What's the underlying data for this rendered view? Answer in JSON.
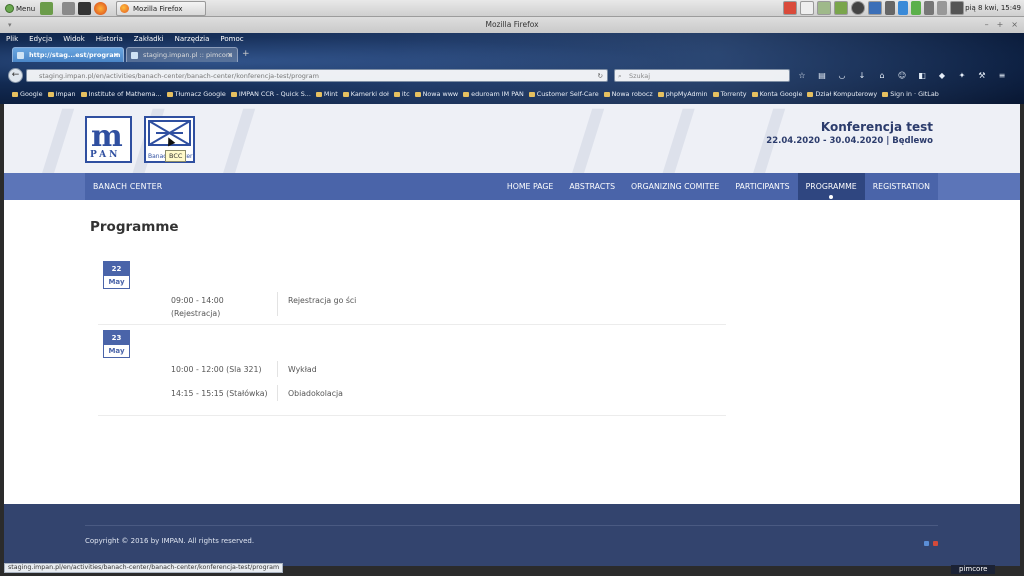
{
  "desktop": {
    "menu_label": "Menu",
    "window_button_label": "Mozilla Firefox",
    "clock": "pią 8 kwi, 15:49"
  },
  "window": {
    "title": "Mozilla Firefox"
  },
  "browser": {
    "menubar": [
      "Plik",
      "Edycja",
      "Widok",
      "Historia",
      "Zakładki",
      "Narzędzia",
      "Pomoc"
    ],
    "tabs": [
      {
        "label": "http://stag...est/program",
        "active": true
      },
      {
        "label": "staging.impan.pl :: pimcore",
        "active": false
      }
    ],
    "url": "staging.impan.pl/en/activities/banach-center/banach-center/konferencja-test/program",
    "search_placeholder": "Szukaj",
    "bookmarks": [
      "Google",
      "impan",
      "Institute of Mathema...",
      "Tłumacz Google",
      "IMPAN CCR - Quick S...",
      "Mint",
      "Kamerki doł",
      "itc",
      "Nowa www",
      "eduroam IM PAN",
      "Customer Self-Care",
      "Nowa robocz",
      "phpMyAdmin",
      "Torrenty",
      "Konta Google",
      "Dział Komputerowy",
      "Sign in · GitLab"
    ],
    "status_url": "staging.impan.pl/en/activities/banach-center/banach-center/konferencja-test/program"
  },
  "site": {
    "logo_impan_m": "m",
    "logo_impan_pan": "PAN",
    "logo_bcc_caption": "Banach Center",
    "tooltip": "BCC",
    "conference_title": "Konferencja test",
    "conference_dates": "22.04.2020 - 30.04.2020 | Będlewo",
    "brand": "BANACH CENTER",
    "nav": [
      {
        "label": "HOME PAGE",
        "active": false
      },
      {
        "label": "ABSTRACTS",
        "active": false
      },
      {
        "label": "ORGANIZING COMITEE",
        "active": false
      },
      {
        "label": "PARTICIPANTS",
        "active": false
      },
      {
        "label": "PROGRAMME",
        "active": true
      },
      {
        "label": "REGISTRATION",
        "active": false
      }
    ],
    "page_title": "Programme",
    "days": [
      {
        "day": "22",
        "month": "May",
        "events": [
          {
            "time": "09:00 - 14:00",
            "place": "(Rejestracja)",
            "title": "Rejestracja go ści"
          }
        ]
      },
      {
        "day": "23",
        "month": "May",
        "events": [
          {
            "time": "10:00 - 12:00 (Sla 321)",
            "place": "",
            "title": "Wykład"
          },
          {
            "time": "14:15 - 15:15 (Stałówka)",
            "place": "",
            "title": "Obiadokolacja"
          }
        ]
      }
    ],
    "footer_copyright": "Copyright © 2016 by IMPAN. All rights reserved.",
    "pimcore_badge": "pimcore"
  },
  "colors": {
    "nav_bar": "#4a64a9",
    "nav_active": "#2f4680",
    "footer": "#33446e",
    "heading": "#2c3c6c"
  }
}
